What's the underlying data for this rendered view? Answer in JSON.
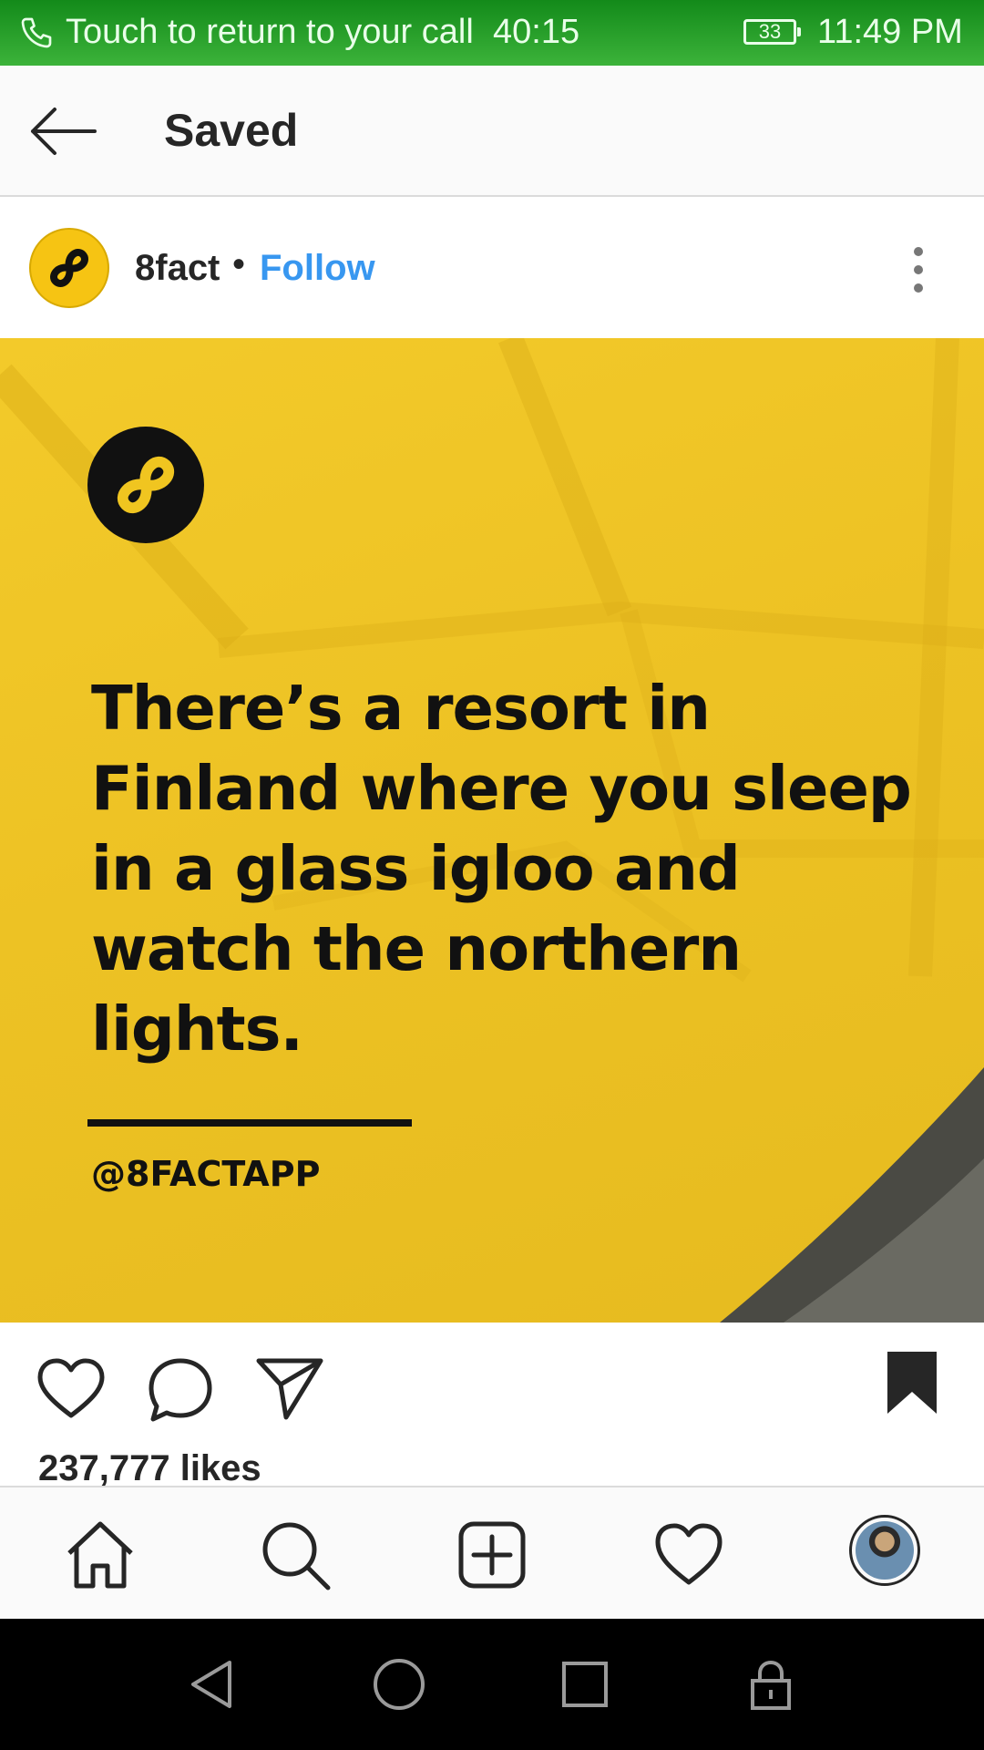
{
  "status_bar": {
    "call_text": "Touch to return to your call",
    "call_timer": "40:15",
    "battery": "33",
    "time": "11:49 PM",
    "icons": [
      "phone-icon",
      "battery-icon"
    ]
  },
  "header": {
    "title": "Saved",
    "back_icon": "arrow-left-icon"
  },
  "post": {
    "username": "8fact",
    "separator": "•",
    "follow_label": "Follow",
    "more_icon": "more-vertical-icon",
    "image": {
      "fact_text": "There’s a resort in Finland where you sleep in a glass igloo and watch the northern lights.",
      "handle": "@8FACTAPP",
      "brand_color": "#f0c520"
    },
    "actions": {
      "icons": [
        "heart-icon",
        "comment-icon",
        "share-icon",
        "bookmark-icon"
      ]
    },
    "likes": "237,777 likes"
  },
  "bottom_nav": {
    "items": [
      "home-icon",
      "search-icon",
      "add-post-icon",
      "activity-heart-icon",
      "profile-avatar"
    ]
  },
  "system_nav": {
    "items": [
      "back-triangle-icon",
      "home-circle-icon",
      "recents-square-icon",
      "lock-icon"
    ]
  },
  "colors": {
    "status_green": "#2aa52c",
    "link_blue": "#3897f0",
    "text_dark": "#262626"
  }
}
